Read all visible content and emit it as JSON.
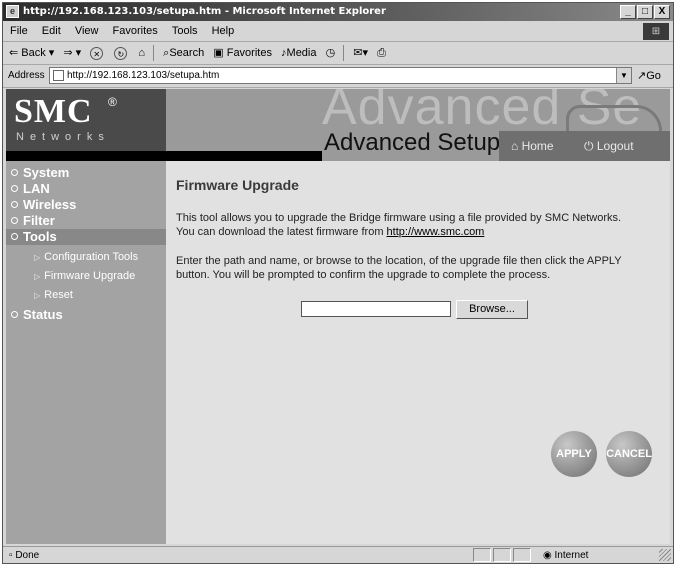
{
  "window": {
    "title": "http://192.168.123.103/setupa.htm - Microsoft Internet Explorer",
    "controls": [
      "_",
      "□",
      "X"
    ]
  },
  "menu": [
    "File",
    "Edit",
    "View",
    "Favorites",
    "Tools",
    "Help"
  ],
  "toolbar": {
    "back": "Back",
    "search": "Search",
    "favorites": "Favorites",
    "media": "Media"
  },
  "address": {
    "label": "Address",
    "url": "http://192.168.123.103/setupa.htm",
    "go": "Go"
  },
  "banner": {
    "brand": "SMC",
    "brand_reg": "®",
    "brand_sub": "Networks",
    "ghost_text": "Advanced Se",
    "title": "Advanced Setup",
    "home": "Home",
    "logout": "Logout"
  },
  "sidebar": {
    "items": [
      {
        "label": "System"
      },
      {
        "label": "LAN"
      },
      {
        "label": "Wireless"
      },
      {
        "label": "Filter"
      },
      {
        "label": "Tools"
      },
      {
        "label": "Status"
      }
    ],
    "sub_items": [
      {
        "label": "Configuration Tools"
      },
      {
        "label": "Firmware Upgrade"
      },
      {
        "label": "Reset"
      }
    ]
  },
  "content": {
    "heading": "Firmware Upgrade",
    "para1_line1": "This tool allows you to upgrade the Bridge firmware using a file provided by SMC Networks.",
    "para1_line2_prefix": "You can download the latest firmware from ",
    "para1_link": "http://www.smc.com",
    "para2": "Enter the path and name, or browse to the location, of the upgrade file then click the APPLY button. You will be prompted to confirm the upgrade to complete the process.",
    "file_value": "",
    "browse_label": "Browse...",
    "apply_label": "APPLY",
    "cancel_label": "CANCEL"
  },
  "status": {
    "text": "Done",
    "zone": "Internet"
  }
}
